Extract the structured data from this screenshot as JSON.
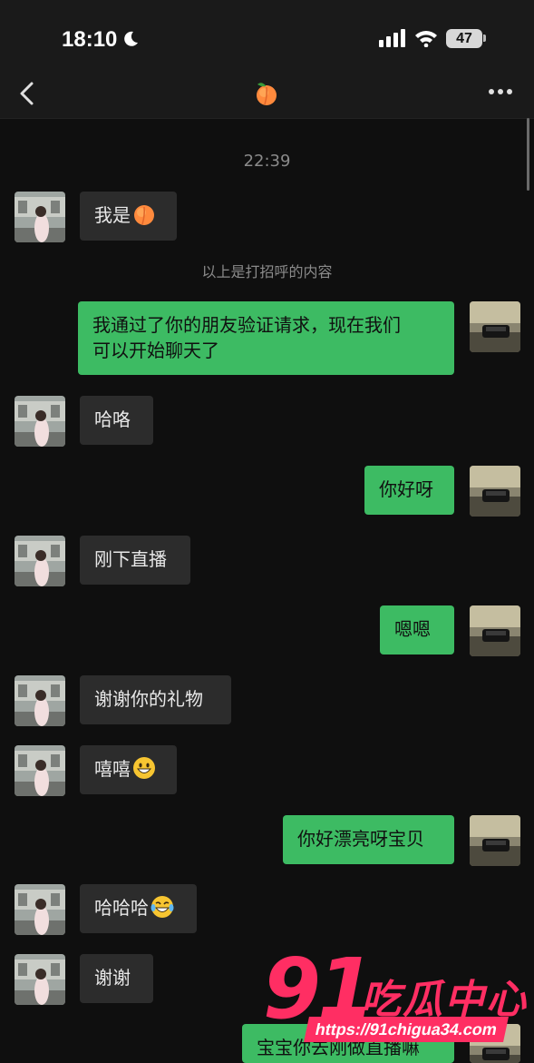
{
  "status_bar": {
    "time": "18:10",
    "battery": "47"
  },
  "nav": {
    "title_icon": "peach-emoji-icon"
  },
  "timestamp": "22:39",
  "system_note": "以上是打招呼的内容",
  "messages": [
    {
      "side": "in",
      "text": "我是"
    },
    {
      "side": "out",
      "lines": [
        "我通过了你的朋友验证请求，现在我们",
        "可以开始聊天了"
      ]
    },
    {
      "side": "in",
      "text": "哈咯"
    },
    {
      "side": "out",
      "text": "你好呀"
    },
    {
      "side": "in",
      "text": "刚下直播"
    },
    {
      "side": "out",
      "text": "嗯嗯"
    },
    {
      "side": "in",
      "text": "谢谢你的礼物"
    },
    {
      "side": "in",
      "text": "嘻嘻"
    },
    {
      "side": "out",
      "text": "你好漂亮呀宝贝"
    },
    {
      "side": "in",
      "text": "哈哈哈"
    },
    {
      "side": "in",
      "text": "谢谢"
    },
    {
      "side": "out",
      "text": "宝宝你去刚做直播嘛"
    }
  ],
  "watermark": {
    "number": "91",
    "brand": "吃瓜中心",
    "url": "https://91chigua34.com"
  },
  "colors": {
    "outgoing_bubble": "#3dbb63",
    "incoming_bubble": "#2c2c2c",
    "background": "#0f0f0f",
    "watermark": "#ff2e63"
  }
}
